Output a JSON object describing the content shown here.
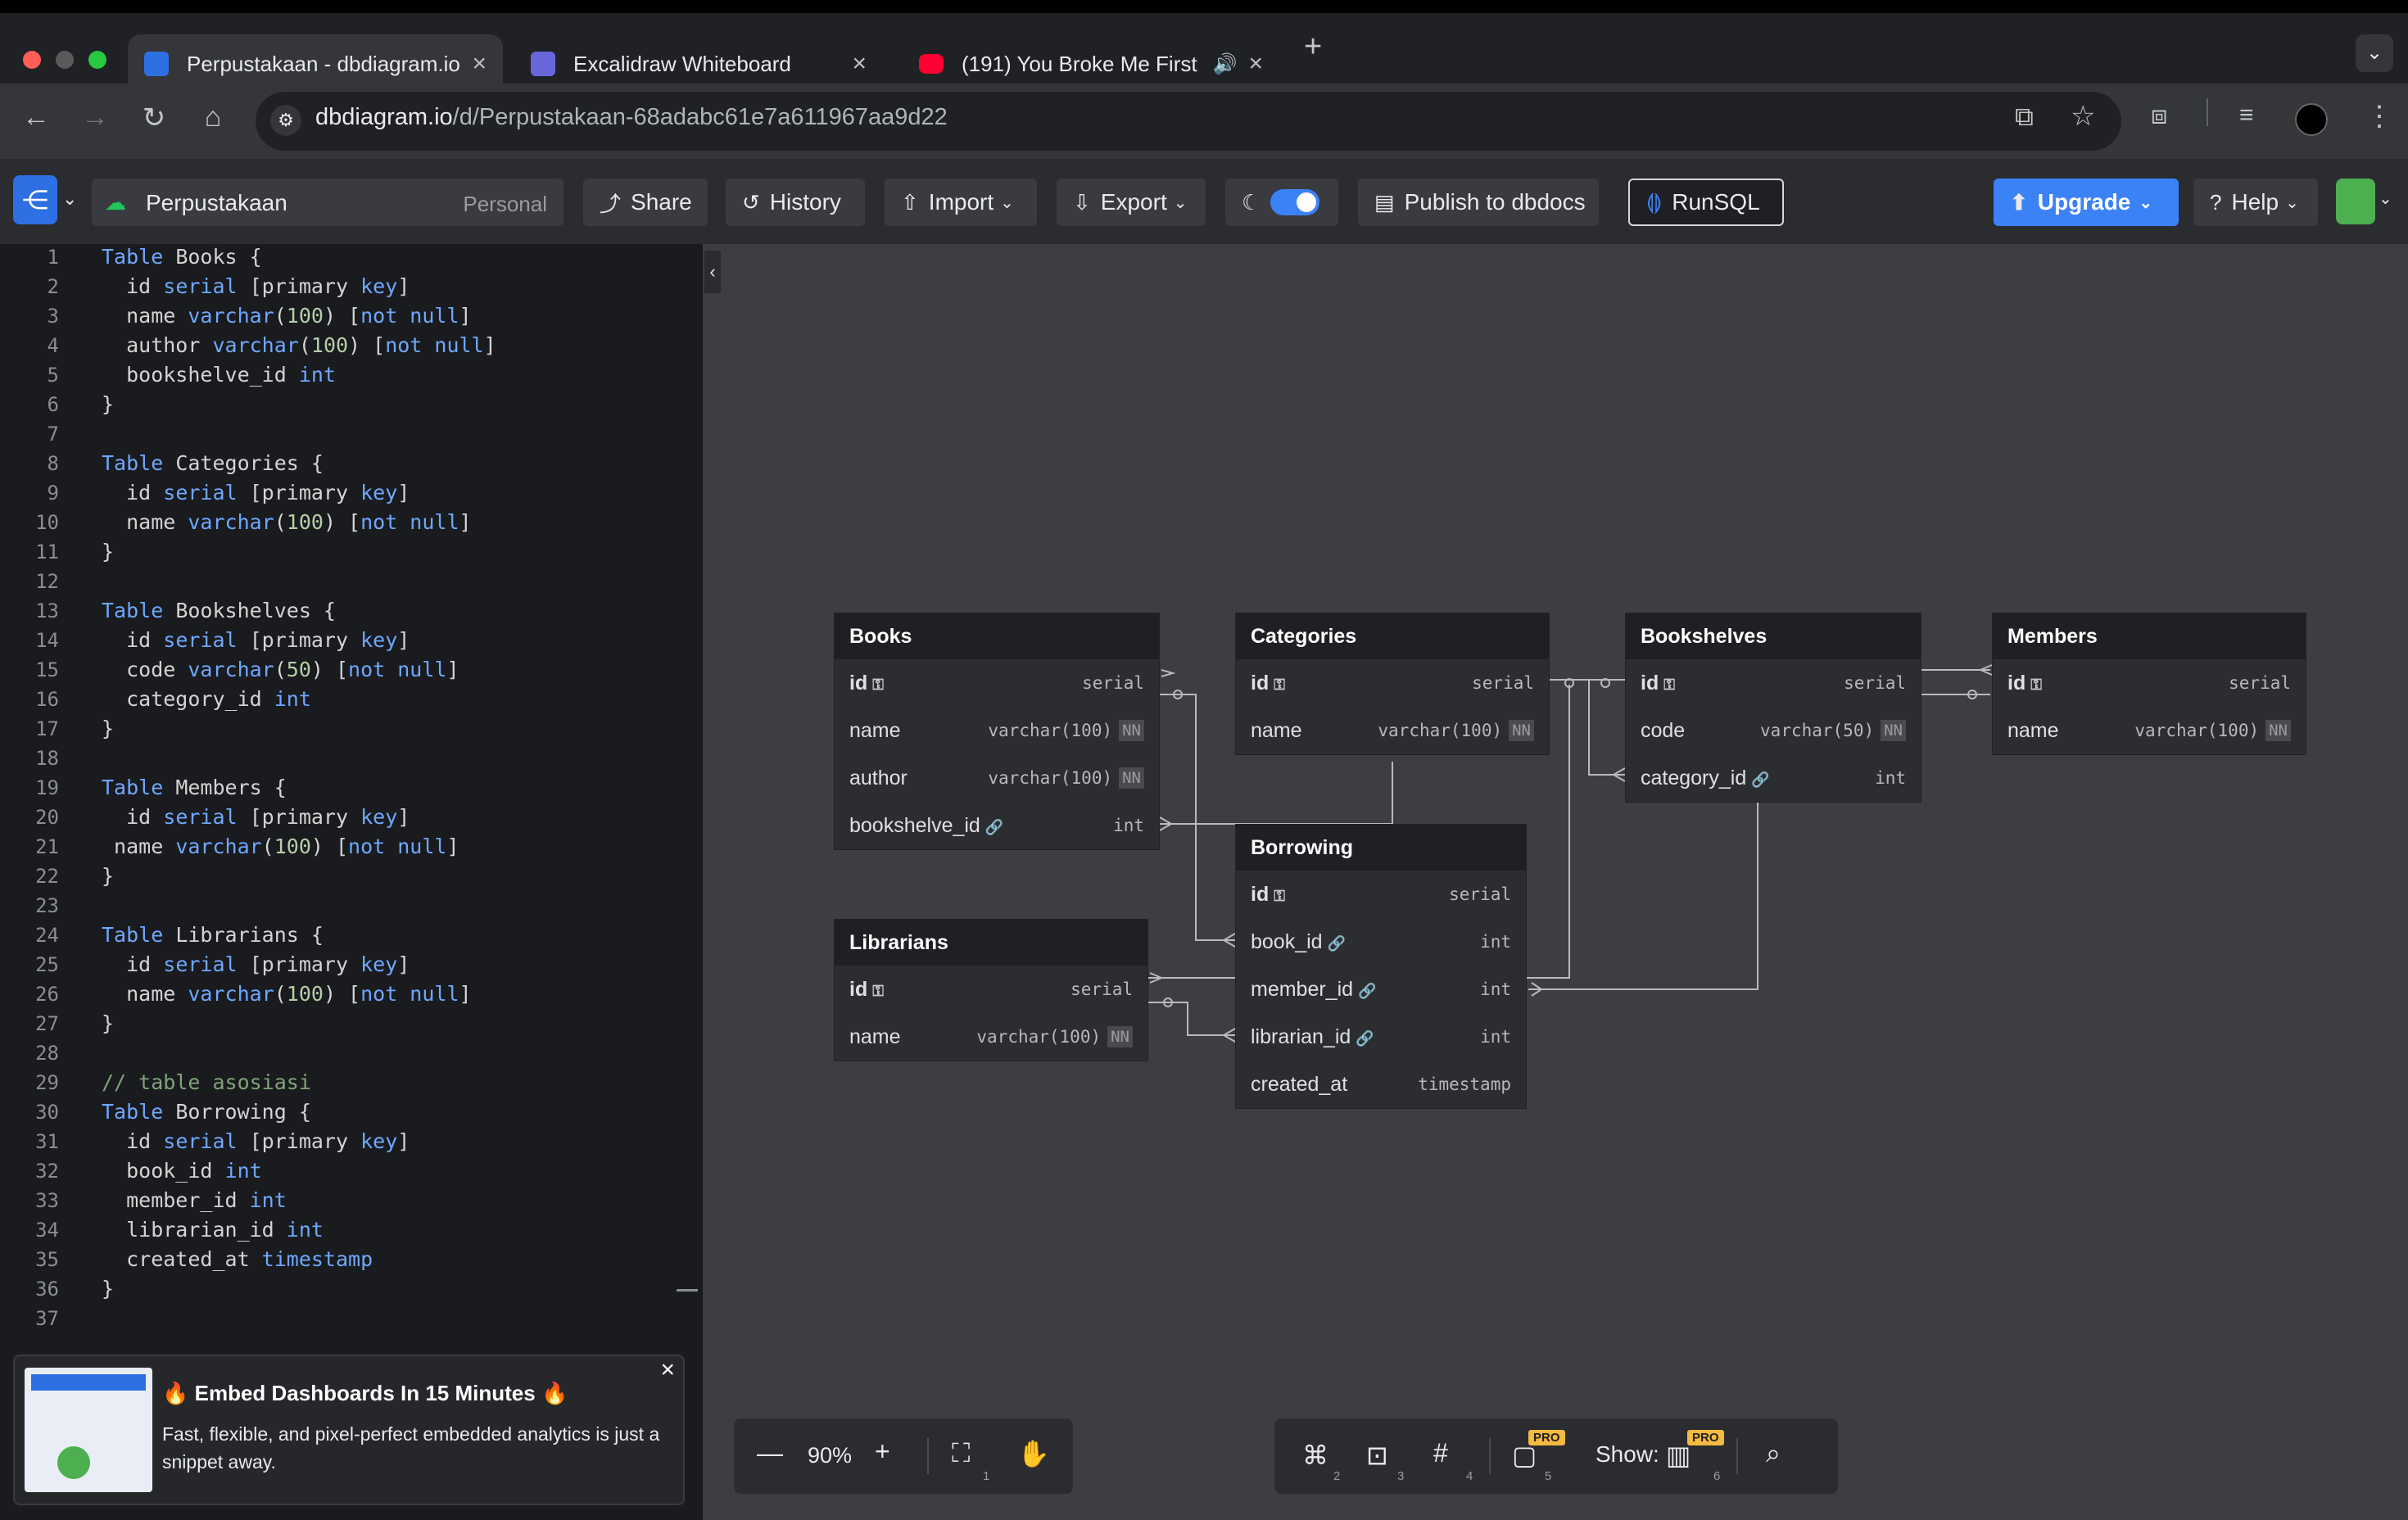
{
  "browser": {
    "tabs": [
      {
        "title": "Perpustakaan - dbdiagram.io",
        "active": true
      },
      {
        "title": "Excalidraw Whiteboard",
        "active": false
      },
      {
        "title": "(191) You Broke Me First",
        "active": false
      }
    ],
    "url_host": "dbdiagram.io",
    "url_path": "/d/Perpustakaan-68adabc61e7a611967aa9d22"
  },
  "toolbar": {
    "project_name": "Perpustakaan",
    "workspace": "Personal",
    "share": "Share",
    "history": "History",
    "import": "Import",
    "export": "Export",
    "publish": "Publish to dbdocs",
    "runsql": "RunSQL",
    "upgrade": "Upgrade",
    "help": "Help"
  },
  "editor": {
    "lines": [
      "1",
      "2",
      "3",
      "4",
      "5",
      "6",
      "7",
      "8",
      "9",
      "10",
      "11",
      "12",
      "13",
      "14",
      "15",
      "16",
      "17",
      "18",
      "19",
      "20",
      "21",
      "22",
      "23",
      "24",
      "25",
      "26",
      "27",
      "28",
      "29",
      "30",
      "31",
      "32",
      "33",
      "34",
      "35",
      "36",
      "37"
    ]
  },
  "tables": {
    "books": {
      "name": "Books",
      "rows": [
        {
          "field": "id",
          "type": "serial"
        },
        {
          "field": "name",
          "type": "varchar(100)",
          "nn": "NN"
        },
        {
          "field": "author",
          "type": "varchar(100)",
          "nn": "NN"
        },
        {
          "field": "bookshelve_id",
          "type": "int"
        }
      ]
    },
    "categories": {
      "name": "Categories",
      "rows": [
        {
          "field": "id",
          "type": "serial"
        },
        {
          "field": "name",
          "type": "varchar(100)",
          "nn": "NN"
        }
      ]
    },
    "bookshelves": {
      "name": "Bookshelves",
      "rows": [
        {
          "field": "id",
          "type": "serial"
        },
        {
          "field": "code",
          "type": "varchar(50)",
          "nn": "NN"
        },
        {
          "field": "category_id",
          "type": "int"
        }
      ]
    },
    "members": {
      "name": "Members",
      "rows": [
        {
          "field": "id",
          "type": "serial"
        },
        {
          "field": "name",
          "type": "varchar(100)",
          "nn": "NN"
        }
      ]
    },
    "borrowing": {
      "name": "Borrowing",
      "rows": [
        {
          "field": "id",
          "type": "serial"
        },
        {
          "field": "book_id",
          "type": "int"
        },
        {
          "field": "member_id",
          "type": "int"
        },
        {
          "field": "librarian_id",
          "type": "int"
        },
        {
          "field": "created_at",
          "type": "timestamp"
        }
      ]
    },
    "librarians": {
      "name": "Librarians",
      "rows": [
        {
          "field": "id",
          "type": "serial"
        },
        {
          "field": "name",
          "type": "varchar(100)",
          "nn": "NN"
        }
      ]
    }
  },
  "ad": {
    "title": "Embed Dashboards In 15 Minutes",
    "body": "Fast, flexible, and pixel-perfect embedded analytics is just a snippet away.",
    "close": "×"
  },
  "bottom": {
    "zoom": "90%",
    "show_label": "Show:",
    "pro": "PRO",
    "shortcuts": [
      "1",
      "2",
      "3",
      "4",
      "5",
      "6"
    ]
  },
  "colors": {
    "accent": "#3b82f6",
    "canvas": "#3d3e44",
    "editor_bg": "#1a1b1e",
    "keyword": "#6ea8ff",
    "pro_badge": "#f4b940"
  }
}
